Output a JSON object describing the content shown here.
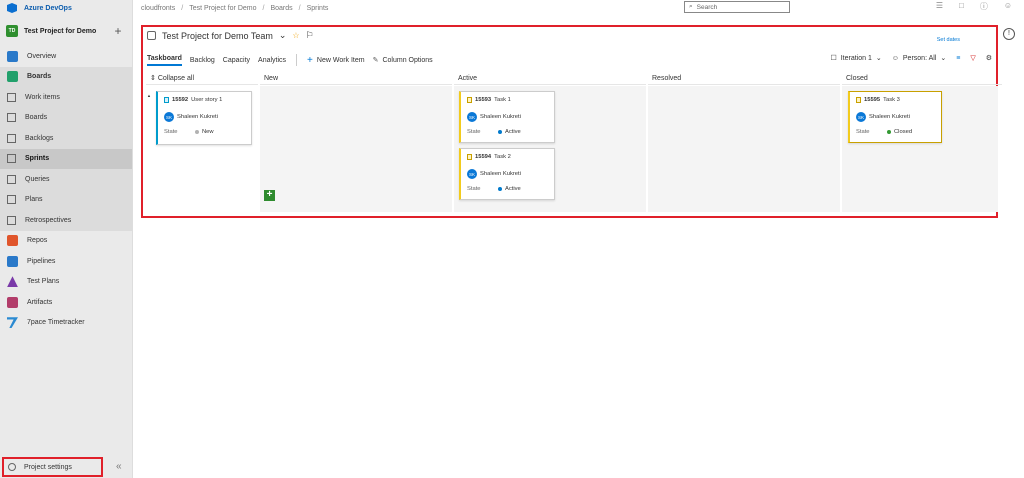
{
  "brand": {
    "name": "Azure DevOps"
  },
  "project": {
    "initials": "TD",
    "name": "Test Project for Demo",
    "add_label": "+"
  },
  "nav": {
    "overview": "Overview",
    "boards": "Boards",
    "work_items": "Work items",
    "boards_sub": "Boards",
    "backlogs": "Backlogs",
    "sprints": "Sprints",
    "queries": "Queries",
    "plans": "Plans",
    "retrospectives": "Retrospectives",
    "repos": "Repos",
    "pipelines": "Pipelines",
    "test_plans": "Test Plans",
    "artifacts": "Artifacts",
    "timetracker": "7pace Timetracker",
    "project_settings": "Project settings",
    "collapse": "«"
  },
  "breadcrumb": [
    "cloudfronts",
    "Test Project for Demo",
    "Boards",
    "Sprints"
  ],
  "search": {
    "placeholder": "Search"
  },
  "team": {
    "title": "Test Project for Demo Team",
    "chevron": "⌄",
    "set_dates": "Set dates"
  },
  "tabs": [
    "Taskboard",
    "Backlog",
    "Capacity",
    "Analytics"
  ],
  "toolbar": {
    "new_work_item": "New Work Item",
    "column_options": "Column Options",
    "iteration": "Iteration 1",
    "person": "Person: All"
  },
  "board": {
    "collapse_all": "Collapse all",
    "columns": [
      "New",
      "Active",
      "Resolved",
      "Closed"
    ],
    "state_label": "State",
    "story": {
      "id": "15592",
      "title": "User story 1",
      "assignee": "Shaleen Kukreti",
      "initials": "SK",
      "state": "New"
    },
    "tasks": [
      {
        "id": "15593",
        "title": "Task 1",
        "assignee": "Shaleen Kukreti",
        "initials": "SK",
        "state": "Active"
      },
      {
        "id": "15594",
        "title": "Task 2",
        "assignee": "Shaleen Kukreti",
        "initials": "SK",
        "state": "Active"
      },
      {
        "id": "15595",
        "title": "Task 3",
        "assignee": "Shaleen Kukreti",
        "initials": "SK",
        "state": "Closed"
      }
    ],
    "add_label": "+"
  },
  "colors": {
    "accent": "#0078d4",
    "highlight": "#e0202a",
    "new": "#b2b2b2",
    "active": "#007acc",
    "closed": "#339933"
  }
}
